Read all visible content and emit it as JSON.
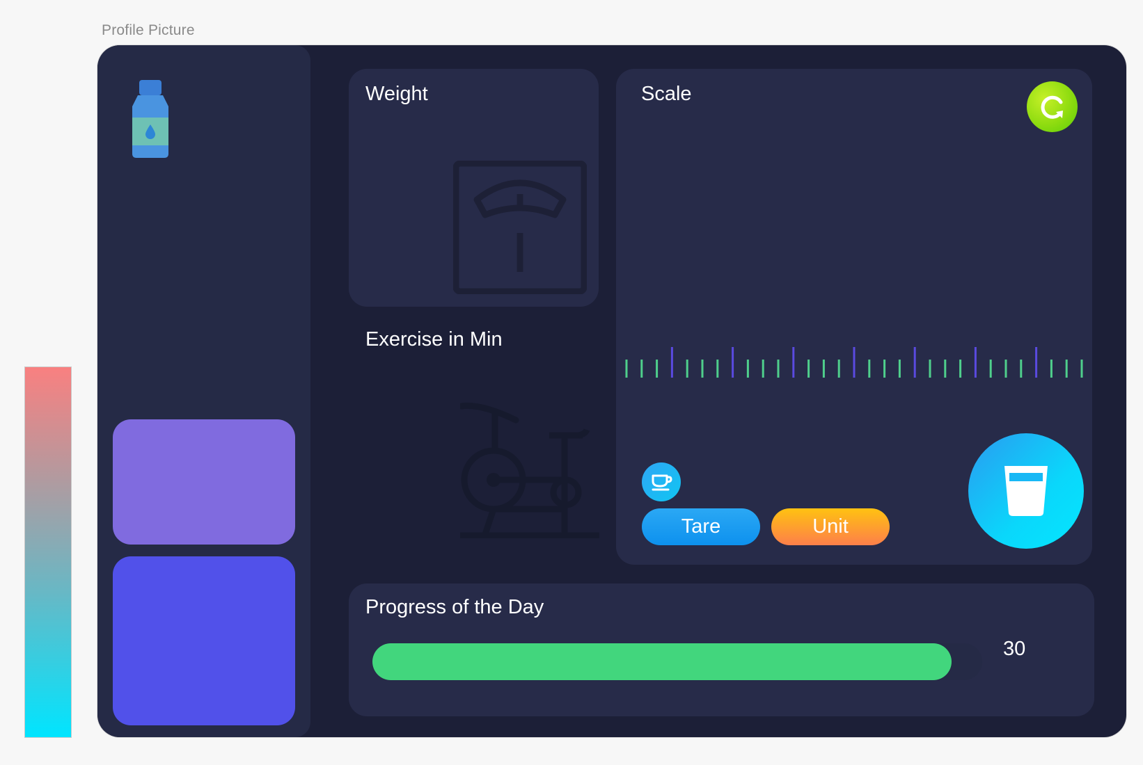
{
  "caption": "Profile Picture",
  "cards": {
    "weight_title": "Weight",
    "scale_title": "Scale",
    "exercise_title": "Exercise in Min",
    "progress_title": "Progress of the Day"
  },
  "buttons": {
    "tare_label": "Tare",
    "unit_label": "Unit"
  },
  "progress": {
    "value_text": "30",
    "fill_fraction": 0.95
  },
  "icons": {
    "sidebar": "water-bottle-icon",
    "weight": "bathroom-scale-icon",
    "exercise": "exercise-bike-icon",
    "refresh": "refresh-icon",
    "cup": "coffee-cup-icon",
    "glass": "water-glass-icon"
  },
  "colors": {
    "background": "#1c1f37",
    "sidebar": "#252a46",
    "card": "#272b49",
    "tile_purple": "#806bdf",
    "tile_blue": "#5151ea",
    "tick_green": "#4fcf8c",
    "tick_accent": "#5a4ae0",
    "progress_fill": "#42d67d"
  }
}
